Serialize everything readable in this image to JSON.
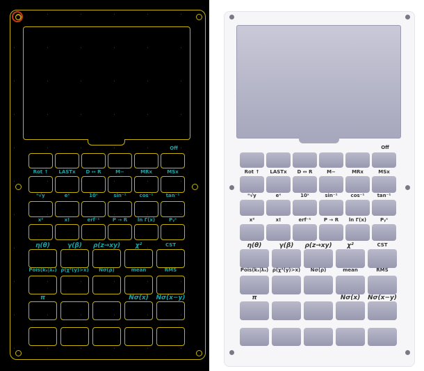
{
  "label_rows": [
    [
      "Rot ↑",
      "LASTx",
      "D ↔ R",
      "M−",
      "MRx",
      "MSx"
    ],
    [
      "ⁿ√y",
      "eˣ",
      "10ˣ",
      "sin⁻¹",
      "cos⁻¹",
      "tan⁻¹"
    ],
    [
      "x²",
      "x!",
      "erf⁻¹",
      "P → R",
      "ln Γ(x)",
      "Pᵧˣ"
    ],
    [
      "η(θ)",
      "γ(β)",
      "ρ(z→xy)",
      "χ²",
      "CST"
    ],
    [
      "Pois(kₓ|λₓ)",
      "ρ(χ²(y)>x)",
      "Nσ(ρ)",
      "mean",
      "RMS"
    ],
    [
      "π",
      "Nσ(x)",
      "Nσ(x−y)"
    ]
  ],
  "top_right_label": "Off",
  "colors": {
    "pcb_background": "#000000",
    "pcb_outline": "#c8b400",
    "pcb_text": "#1aa3a8",
    "render_plate": "#f6f6f8",
    "render_key": "#a5a5bb",
    "render_text": "#333333"
  }
}
